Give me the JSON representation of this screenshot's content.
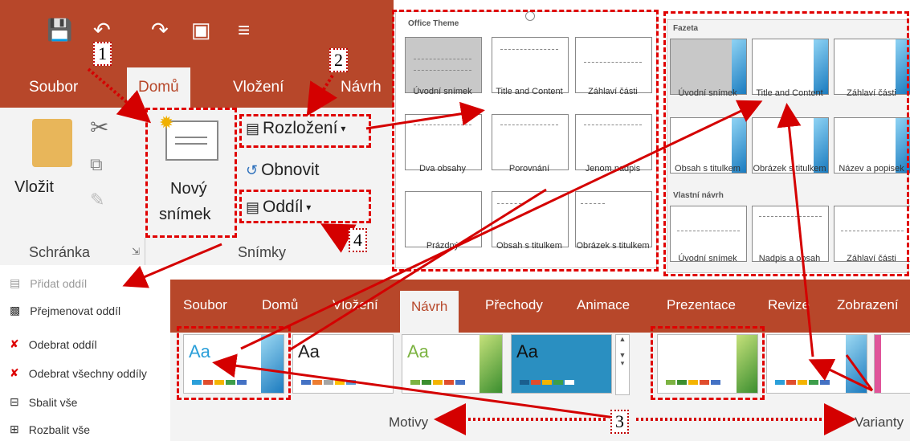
{
  "ribbon": {
    "tabs": [
      "Soubor",
      "Domů",
      "Vložení",
      "Návrh"
    ],
    "paste_label": "Vložit",
    "clipboard_group": "Schránka",
    "new_slide_line1": "Nový",
    "new_slide_line2": "snímek",
    "layout_label": "Rozložení",
    "reset_label": "Obnovit",
    "section_label": "Oddíl",
    "slides_group": "Snímky"
  },
  "layout_gallery_office": {
    "header": "Office Theme",
    "items": [
      "Úvodní snímek",
      "Title and Content",
      "Záhlaví části",
      "Dva obsahy",
      "Porovnání",
      "Jenom nadpis",
      "Prázdný",
      "Obsah s titulkem",
      "Obrázek s titulkem"
    ]
  },
  "layout_gallery_facet": {
    "header": "Fazeta",
    "items": [
      "Úvodní snímek",
      "Title and Content",
      "Záhlaví části",
      "Obsah s titulkem",
      "Obrázek s titulkem",
      "Název a popisek"
    ],
    "custom_header": "Vlastní návrh",
    "custom_items": [
      "Úvodní snímek",
      "Nadpis a obsah",
      "Záhlaví části"
    ]
  },
  "section_menu": {
    "items": [
      "Přidat oddíl",
      "Přejmenovat oddíl",
      "Odebrat oddíl",
      "Odebrat všechny oddíly",
      "Sbalit vše",
      "Rozbalit vše"
    ]
  },
  "design_ribbon": {
    "tabs": [
      "Soubor",
      "Domů",
      "Vložení",
      "Návrh",
      "Přechody",
      "Animace",
      "Prezentace",
      "Revize",
      "Zobrazení"
    ],
    "themes_label": "Motivy",
    "variants_label": "Varianty"
  },
  "callouts": [
    "1",
    "2",
    "3",
    "4"
  ],
  "colors": {
    "ribbon": "#b7472a",
    "highlight": "#e00000"
  }
}
